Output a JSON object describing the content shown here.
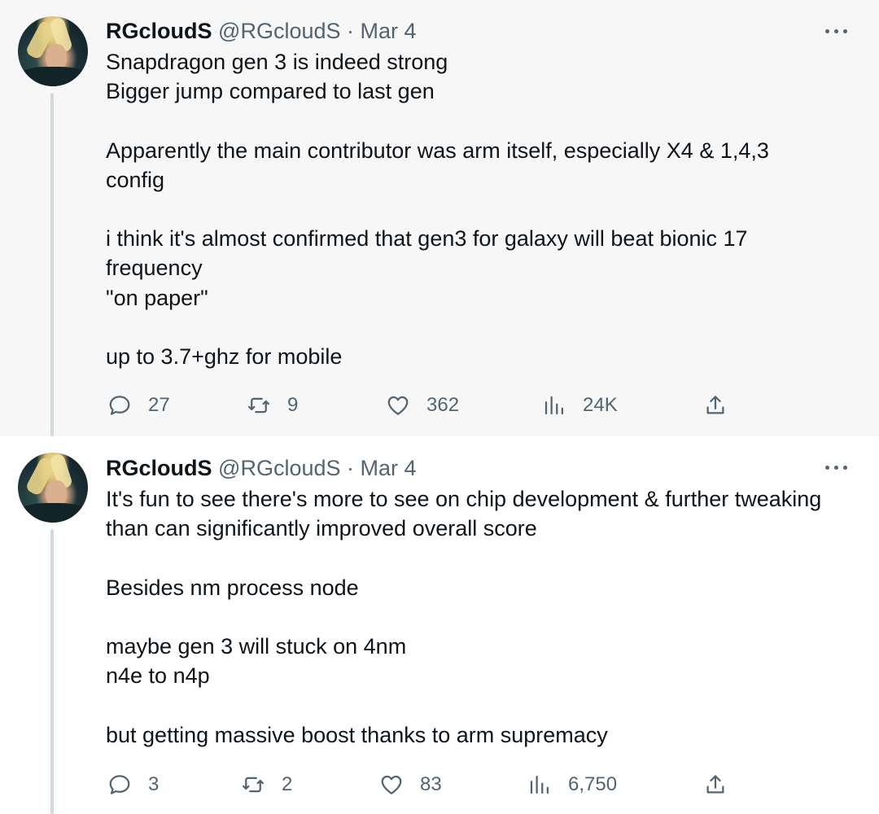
{
  "tweets": [
    {
      "name": "RGcloudS",
      "handle": "@RGcloudS",
      "separator": "·",
      "date": "Mar 4",
      "lines": [
        "Snapdragon gen 3 is indeed strong",
        "Bigger jump compared to last gen",
        "",
        "Apparently the main contributor was arm itself, especially X4 & 1,4,3",
        "config",
        "",
        "i think it's almost confirmed that gen3 for galaxy will beat bionic 17",
        "frequency",
        "\"on paper\"",
        "",
        "up to 3.7+ghz for mobile"
      ],
      "stats": {
        "replies": "27",
        "retweets": "9",
        "likes": "362",
        "views": "24K"
      }
    },
    {
      "name": "RGcloudS",
      "handle": "@RGcloudS",
      "separator": "·",
      "date": "Mar 4",
      "lines": [
        "It's fun to see there's more to see on chip development & further tweaking",
        "than can significantly improved overall score",
        "",
        "Besides nm process node",
        "",
        "maybe gen 3 will stuck on 4nm",
        "n4e to n4p",
        "",
        "but getting massive boost thanks to arm supremacy"
      ],
      "stats": {
        "replies": "3",
        "retweets": "2",
        "likes": "83",
        "views": "6,750"
      }
    }
  ],
  "icons": {
    "more": "more-dots-icon",
    "reply": "reply-icon",
    "retweet": "retweet-icon",
    "like": "heart-icon",
    "views": "views-chart-icon",
    "share": "share-icon"
  },
  "colors": {
    "text": "#0f1419",
    "secondary": "#536471",
    "thread": "#cfd9de",
    "highlight_bg": "#f7f7f7"
  }
}
